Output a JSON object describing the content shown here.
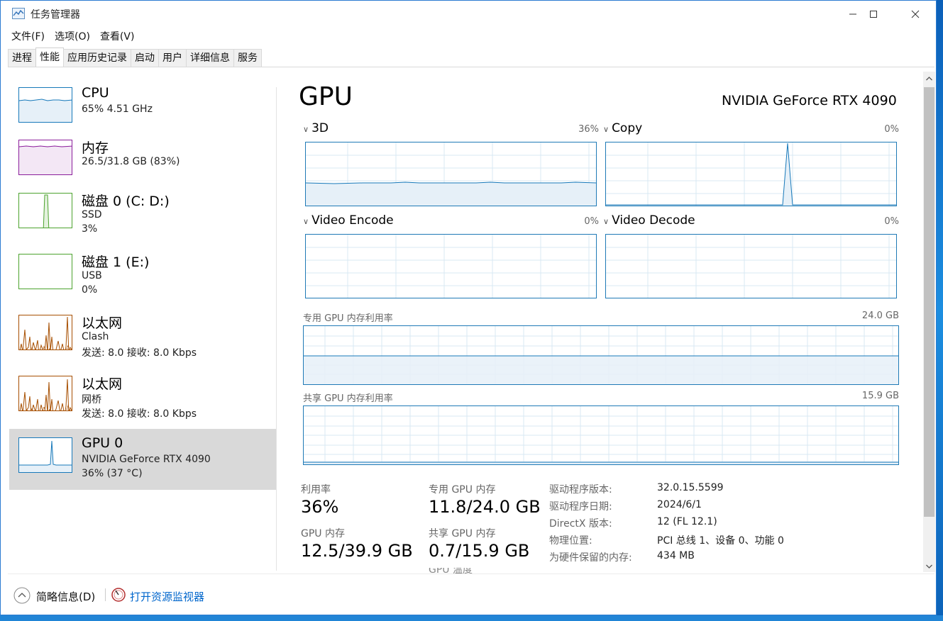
{
  "window": {
    "title": "任务管理器"
  },
  "menu": {
    "items": [
      "文件(F)",
      "选项(O)",
      "查看(V)"
    ]
  },
  "tabs": [
    "进程",
    "性能",
    "应用历史记录",
    "启动",
    "用户",
    "详细信息",
    "服务"
  ],
  "active_tab": "性能",
  "sidebar": {
    "items": [
      {
        "title": "CPU",
        "sub1": "65% 4.51 GHz",
        "sub2": "",
        "color": "#1779ba",
        "percent": 65
      },
      {
        "title": "内存",
        "sub1": "26.5/31.8 GB (83%)",
        "sub2": "",
        "color": "#8b1e9b",
        "percent": 83
      },
      {
        "title": "磁盘 0 (C: D:)",
        "sub1": "SSD",
        "sub2": "3%",
        "color": "#4ca32e",
        "percent": 3
      },
      {
        "title": "磁盘 1 (E:)",
        "sub1": "USB",
        "sub2": "0%",
        "color": "#4ca32e",
        "percent": 0
      },
      {
        "title": "以太网",
        "sub1": "Clash",
        "sub2": "发送: 8.0 接收: 8.0 Kbps",
        "color": "#a74f01"
      },
      {
        "title": "以太网",
        "sub1": "网桥",
        "sub2": "发送: 8.0 接收: 8.0 Kbps",
        "color": "#a74f01"
      },
      {
        "title": "GPU 0",
        "sub1": "NVIDIA GeForce RTX 4090",
        "sub2": "36% (37 °C)",
        "color": "#1779ba",
        "percent": 36
      }
    ]
  },
  "gpu": {
    "heading": "GPU",
    "model": "NVIDIA GeForce RTX 4090",
    "engines": [
      {
        "label": "3D",
        "percent_text": "36%",
        "percent": 36
      },
      {
        "label": "Copy",
        "percent_text": "0%",
        "percent": 0
      },
      {
        "label": "Video Encode",
        "percent_text": "0%",
        "percent": 0
      },
      {
        "label": "Video Decode",
        "percent_text": "0%",
        "percent": 0
      }
    ],
    "dedicated_mem": {
      "label": "专用 GPU 内存利用率",
      "max": "24.0 GB",
      "fraction": 0.49
    },
    "shared_mem": {
      "label": "共享 GPU 内存利用率",
      "max": "15.9 GB",
      "fraction": 0.04
    }
  },
  "stats": {
    "utilization": {
      "label": "利用率",
      "value": "36%"
    },
    "dedicated": {
      "label": "专用 GPU 内存",
      "value": "11.8/24.0 GB"
    },
    "gpu_mem": {
      "label": "GPU 内存",
      "value": "12.5/39.9 GB"
    },
    "shared": {
      "label": "共享 GPU 内存",
      "value": "0.7/15.9 GB"
    },
    "cut_label": "GPU 温度"
  },
  "info": [
    {
      "key": "驱动程序版本:",
      "value": "32.0.15.5599"
    },
    {
      "key": "驱动程序日期:",
      "value": "2024/6/1"
    },
    {
      "key": "DirectX 版本:",
      "value": "12 (FL 12.1)"
    },
    {
      "key": "物理位置:",
      "value": "PCI 总线 1、设备 0、功能 0"
    },
    {
      "key": "为硬件保留的内存:",
      "value": "434 MB"
    }
  ],
  "footer": {
    "fewer_details": "简略信息(D)",
    "resource_monitor": "打开资源监视器"
  },
  "colors": {
    "accent": "#1779ba",
    "link": "#0066cc",
    "selected_bg": "#d9d9d9"
  }
}
